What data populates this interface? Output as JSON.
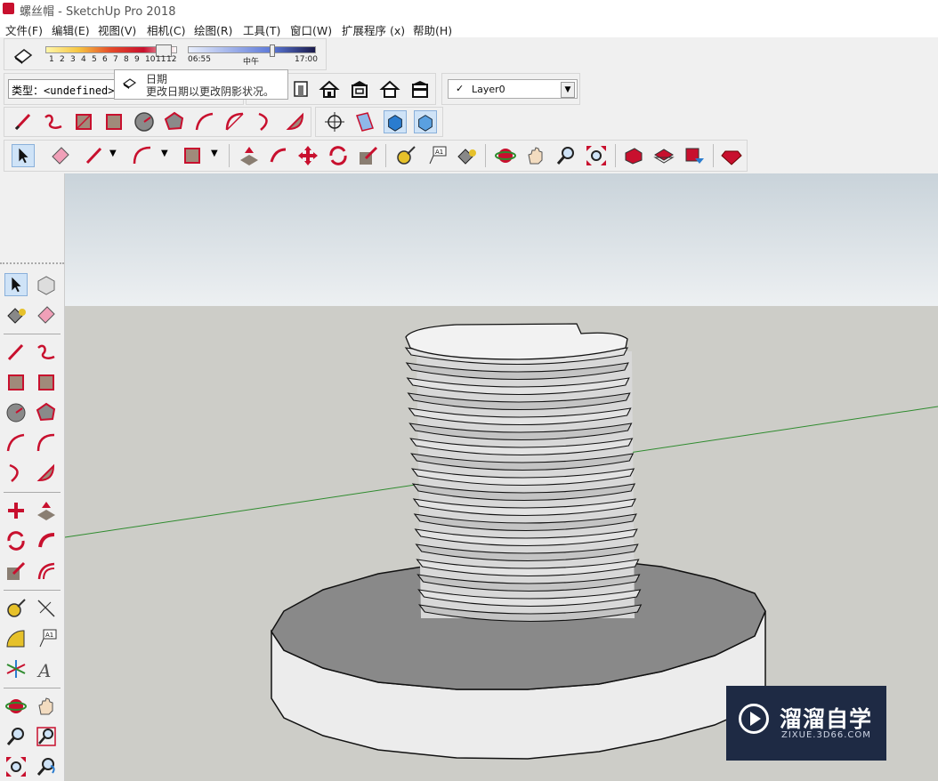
{
  "window": {
    "title": "螺丝帽 - SketchUp Pro 2018"
  },
  "menu": [
    "文件(F)",
    "编辑(E)",
    "视图(V)",
    "相机(C)",
    "绘图(R)",
    "工具(T)",
    "窗口(W)",
    "扩展程序 (x)",
    "帮助(H)"
  ],
  "shadows": {
    "months": [
      "1",
      "2",
      "3",
      "4",
      "5",
      "6",
      "7",
      "8",
      "9",
      "10",
      "11",
      "12"
    ],
    "time_start": "06:55",
    "time_mid": "中午",
    "time_end": "17:00"
  },
  "entity_type": {
    "label": "类型：",
    "value": "<undefined>"
  },
  "tooltip": {
    "title": "日期",
    "desc": "更改日期以更改阴影状况。"
  },
  "layer": {
    "name": "Layer0"
  },
  "colors": {
    "accent": "#c8102e",
    "sky_top": "#c9d3da",
    "ground": "#cdcdc8",
    "axis_green": "#2e8b2e"
  },
  "watermark": {
    "brand": "溜溜自学",
    "url": "ZIXUE.3D66.COM"
  }
}
